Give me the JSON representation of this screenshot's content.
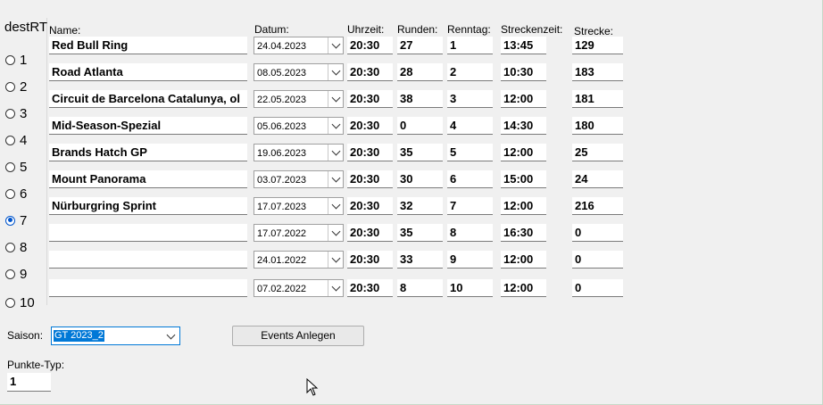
{
  "radio_group": {
    "title": "destRT",
    "options": [
      "1",
      "2",
      "3",
      "4",
      "5",
      "6",
      "7",
      "8",
      "9",
      "10"
    ],
    "selected_index": 6
  },
  "headers": {
    "name": "Name:",
    "datum": "Datum:",
    "uhrzeit": "Uhrzeit:",
    "runden": "Runden:",
    "renntag": "Renntag:",
    "streckenzeit": "Streckenzeit:",
    "strecke": "Strecke:"
  },
  "rows": [
    {
      "name": "Red Bull Ring",
      "datum": "24.04.2023",
      "uhrzeit": "20:30",
      "runden": "27",
      "renntag": "1",
      "streckenzeit": "13:45",
      "strecke": "129"
    },
    {
      "name": "Road Atlanta",
      "datum": "08.05.2023",
      "uhrzeit": "20:30",
      "runden": "28",
      "renntag": "2",
      "streckenzeit": "10:30",
      "strecke": "183"
    },
    {
      "name": "Circuit de Barcelona Catalunya, ol",
      "datum": "22.05.2023",
      "uhrzeit": "20:30",
      "runden": "38",
      "renntag": "3",
      "streckenzeit": "12:00",
      "strecke": "181"
    },
    {
      "name": "Mid-Season-Spezial",
      "datum": "05.06.2023",
      "uhrzeit": "20:30",
      "runden": "0",
      "renntag": "4",
      "streckenzeit": "14:30",
      "strecke": "180"
    },
    {
      "name": "Brands Hatch GP",
      "datum": "19.06.2023",
      "uhrzeit": "20:30",
      "runden": "35",
      "renntag": "5",
      "streckenzeit": "12:00",
      "strecke": "25"
    },
    {
      "name": "Mount Panorama",
      "datum": "03.07.2023",
      "uhrzeit": "20:30",
      "runden": "30",
      "renntag": "6",
      "streckenzeit": "15:00",
      "strecke": "24"
    },
    {
      "name": "Nürburgring Sprint",
      "datum": "17.07.2023",
      "uhrzeit": "20:30",
      "runden": "32",
      "renntag": "7",
      "streckenzeit": "12:00",
      "strecke": "216"
    },
    {
      "name": "",
      "datum": "17.07.2022",
      "uhrzeit": "20:30",
      "runden": "35",
      "renntag": "8",
      "streckenzeit": "16:30",
      "strecke": "0"
    },
    {
      "name": "",
      "datum": "24.01.2022",
      "uhrzeit": "20:30",
      "runden": "33",
      "renntag": "9",
      "streckenzeit": "12:00",
      "strecke": "0"
    },
    {
      "name": "",
      "datum": "07.02.2022",
      "uhrzeit": "20:30",
      "runden": "8",
      "renntag": "10",
      "streckenzeit": "12:00",
      "strecke": "0"
    }
  ],
  "saison": {
    "label": "Saison:",
    "value": "GT 2023_2"
  },
  "events_button": {
    "label": "Events Anlegen"
  },
  "punkte_typ": {
    "label": "Punkte-Typ:",
    "value": "1"
  },
  "colors": {
    "selection": "#0078d7",
    "radio_checked": "#0055cc",
    "background": "#f0f0f0"
  },
  "icons": {
    "dropdown": "chevron-down-icon",
    "cursor": "mouse-pointer-icon"
  }
}
